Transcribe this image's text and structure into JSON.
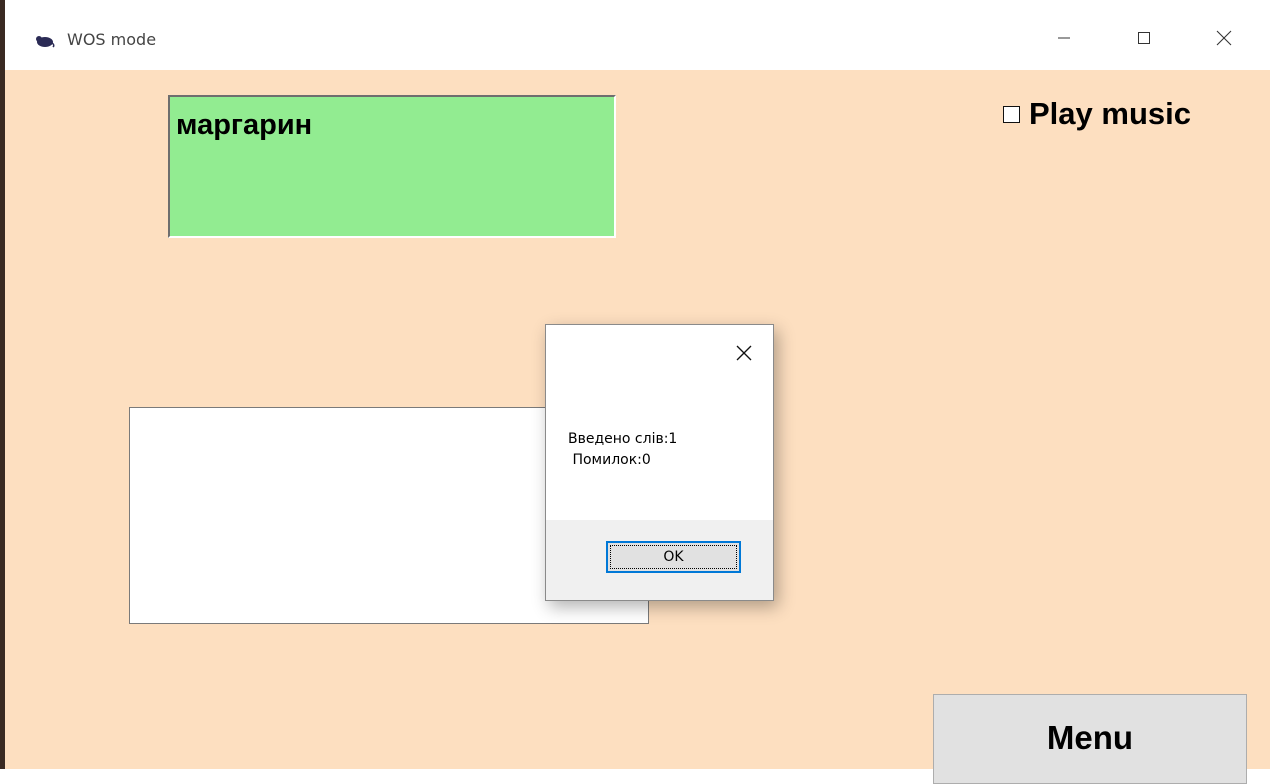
{
  "window": {
    "title": "WOS mode",
    "app_icon": "mouse-icon",
    "controls": [
      "minimize-icon",
      "maximize-icon",
      "close-icon"
    ]
  },
  "main": {
    "target_word": "маргарин",
    "play_music_label": "Play music",
    "play_music_checked": false,
    "input_value": "",
    "menu_label": "Menu"
  },
  "dialog": {
    "message": "Введено слів:1\n Помилок:0",
    "ok_label": "OK",
    "close_icon": "close-icon"
  },
  "colors": {
    "background": "#fddfc0",
    "word_box": "#92ec91",
    "accent_focus": "#0078d7"
  }
}
